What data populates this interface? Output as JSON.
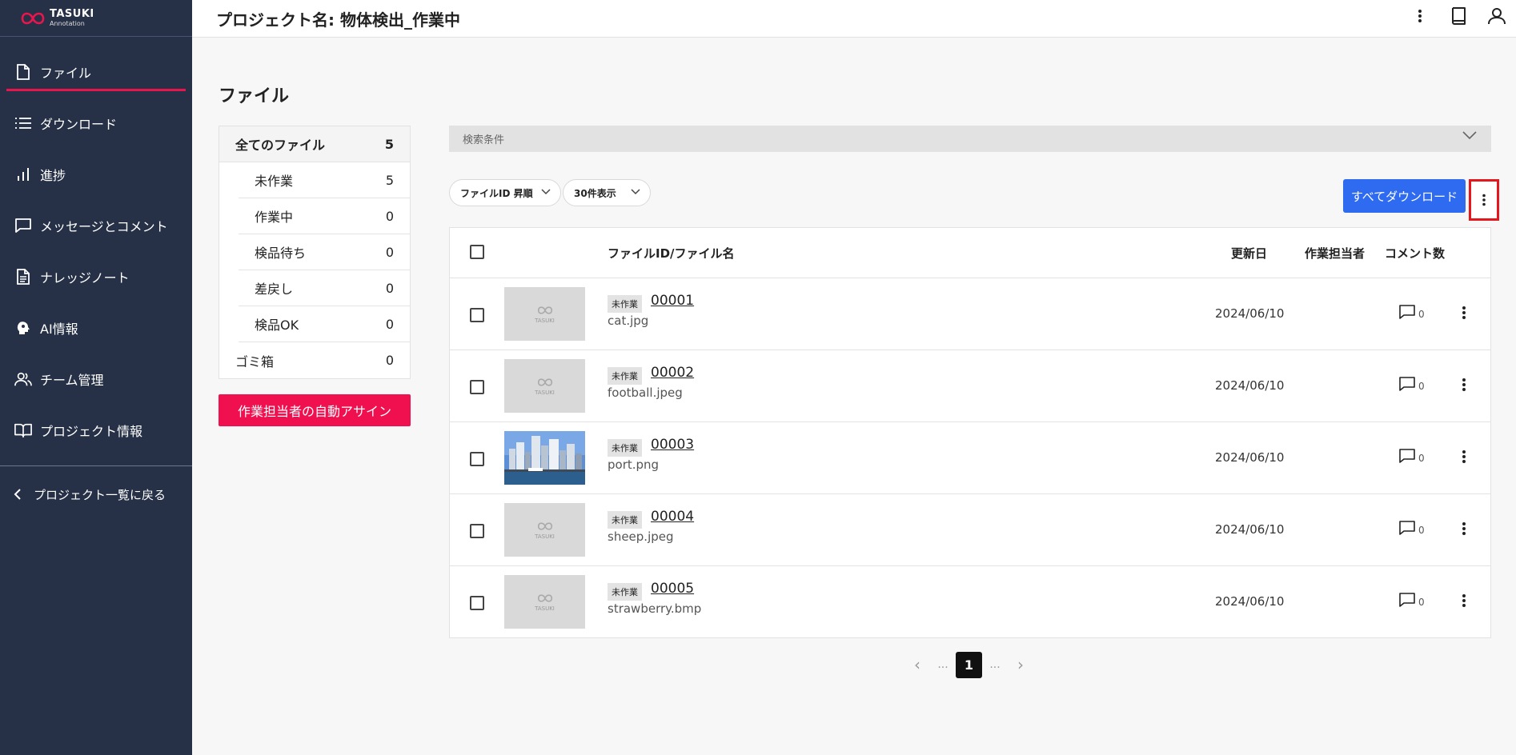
{
  "app": {
    "logo_name": "TASUKI",
    "logo_sub": "Annotation",
    "brand_color": "#e8164d",
    "sidebar_bg": "#263046"
  },
  "header": {
    "title": "プロジェクト名: 物体検出_作業中",
    "icons": [
      "more-vertical-icon",
      "book-icon",
      "user-icon"
    ]
  },
  "sidebar": {
    "items": [
      {
        "label": "ファイル",
        "icon": "file-icon",
        "active": true
      },
      {
        "label": "ダウンロード",
        "icon": "list-icon"
      },
      {
        "label": "進捗",
        "icon": "bar-chart-icon"
      },
      {
        "label": "メッセージとコメント",
        "icon": "message-icon"
      },
      {
        "label": "ナレッジノート",
        "icon": "document-icon"
      },
      {
        "label": "AI情報",
        "icon": "ai-head-icon"
      },
      {
        "label": "チーム管理",
        "icon": "team-icon"
      },
      {
        "label": "プロジェクト情報",
        "icon": "open-book-icon"
      }
    ],
    "back_label": "プロジェクト一覧に戻る"
  },
  "main": {
    "title": "ファイル",
    "status": [
      {
        "label": "全てのファイル",
        "count": "5"
      },
      {
        "label": "未作業",
        "count": "5"
      },
      {
        "label": "作業中",
        "count": "0"
      },
      {
        "label": "検品待ち",
        "count": "0"
      },
      {
        "label": "差戻し",
        "count": "0"
      },
      {
        "label": "検品OK",
        "count": "0"
      },
      {
        "label": "ゴミ箱",
        "count": "0"
      }
    ],
    "assign_button": "作業担当者の自動アサイン",
    "search_label": "検索条件",
    "sort_select": "ファイルID 昇順",
    "per_page_select": "30件表示",
    "download_all_button": "すべてダウンロード",
    "table": {
      "headers": {
        "file": "ファイルID/ファイル名",
        "updated": "更新日",
        "assignee": "作業担当者",
        "comments": "コメント数"
      },
      "rows": [
        {
          "status": "未作業",
          "id": "00001",
          "name": "cat.jpg",
          "date": "2024/06/10",
          "assignee": "",
          "comments": "0",
          "thumb": "placeholder"
        },
        {
          "status": "未作業",
          "id": "00002",
          "name": "football.jpeg",
          "date": "2024/06/10",
          "assignee": "",
          "comments": "0",
          "thumb": "placeholder"
        },
        {
          "status": "未作業",
          "id": "00003",
          "name": "port.png",
          "date": "2024/06/10",
          "assignee": "",
          "comments": "0",
          "thumb": "photo"
        },
        {
          "status": "未作業",
          "id": "00004",
          "name": "sheep.jpeg",
          "date": "2024/06/10",
          "assignee": "",
          "comments": "0",
          "thumb": "placeholder"
        },
        {
          "status": "未作業",
          "id": "00005",
          "name": "strawberry.bmp",
          "date": "2024/06/10",
          "assignee": "",
          "comments": "0",
          "thumb": "placeholder"
        }
      ],
      "thumb_placeholder_text": "TASUKI"
    },
    "pagination": {
      "prev": "‹",
      "ellipsis_left": "...",
      "current": "1",
      "ellipsis_right": "...",
      "next": "›"
    }
  }
}
